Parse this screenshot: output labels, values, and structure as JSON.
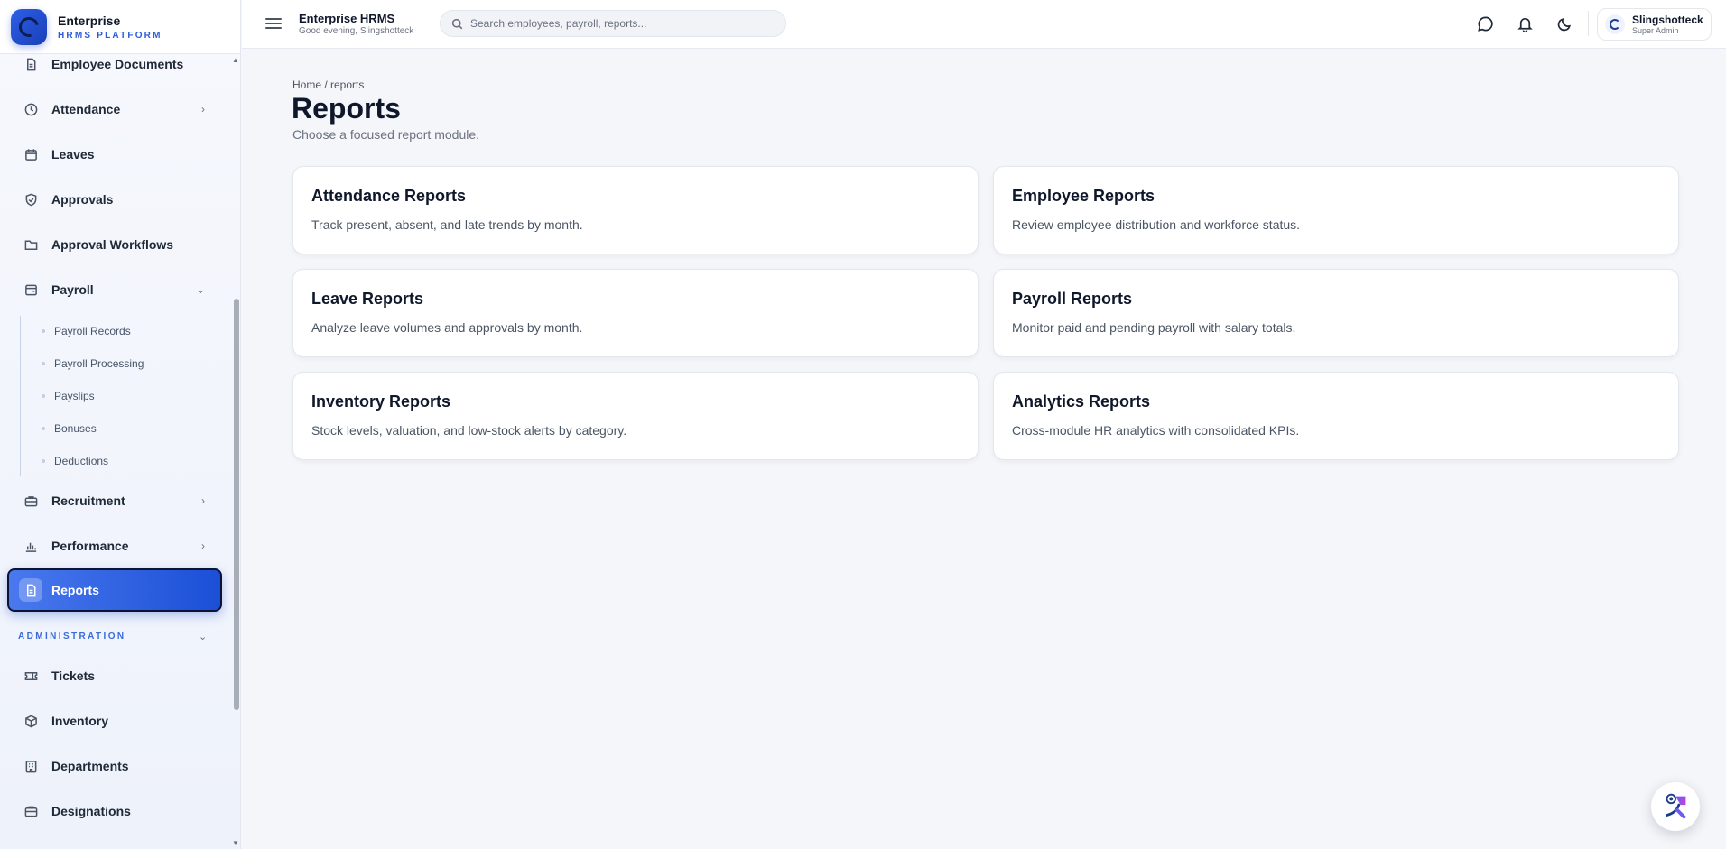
{
  "brand": {
    "name": "Enterprise",
    "subtitle": "HRMS PLATFORM"
  },
  "header": {
    "title": "Enterprise HRMS",
    "greeting": "Good evening, Slingshotteck",
    "search_placeholder": "Search employees, payroll, reports...",
    "icons": [
      "chat-icon",
      "bell-icon",
      "moon-icon"
    ],
    "user": {
      "name": "Slingshotteck",
      "role": "Super Admin"
    }
  },
  "sidebar": {
    "items": [
      {
        "label": "Employee Documents",
        "icon": "document-icon"
      },
      {
        "label": "Attendance",
        "icon": "clock-icon",
        "chevron": "›"
      },
      {
        "label": "Leaves",
        "icon": "calendar-icon"
      },
      {
        "label": "Approvals",
        "icon": "shield-check-icon"
      },
      {
        "label": "Approval Workflows",
        "icon": "folder-icon"
      },
      {
        "label": "Payroll",
        "icon": "wallet-icon",
        "chevron": "⌄"
      },
      {
        "label": "Recruitment",
        "icon": "briefcase-icon",
        "chevron": "›"
      },
      {
        "label": "Performance",
        "icon": "bar-chart-icon",
        "chevron": "›"
      },
      {
        "label": "Reports",
        "icon": "report-icon"
      },
      {
        "label": "Tickets",
        "icon": "ticket-icon"
      },
      {
        "label": "Inventory",
        "icon": "box-icon"
      },
      {
        "label": "Departments",
        "icon": "building-icon"
      },
      {
        "label": "Designations",
        "icon": "badge-icon"
      }
    ],
    "payroll_sub": [
      "Payroll Records",
      "Payroll Processing",
      "Payslips",
      "Bonuses",
      "Deductions"
    ],
    "section_admin": "ADMINISTRATION",
    "section_chev": "⌄"
  },
  "main": {
    "breadcrumb": "Home / reports",
    "title": "Reports",
    "subtitle": "Choose a focused report module.",
    "cards": [
      {
        "title": "Attendance Reports",
        "desc": "Track present, absent, and late trends by month."
      },
      {
        "title": "Employee Reports",
        "desc": "Review employee distribution and workforce status."
      },
      {
        "title": "Leave Reports",
        "desc": "Analyze leave volumes and approvals by month."
      },
      {
        "title": "Payroll Reports",
        "desc": "Monitor paid and pending payroll with salary totals."
      },
      {
        "title": "Inventory Reports",
        "desc": "Stock levels, valuation, and low-stock alerts by category."
      },
      {
        "title": "Analytics Reports",
        "desc": "Cross-module HR analytics with consolidated KPIs."
      }
    ]
  },
  "colors": {
    "accent": "#1b4fd6",
    "background": "#f5f6fa"
  }
}
